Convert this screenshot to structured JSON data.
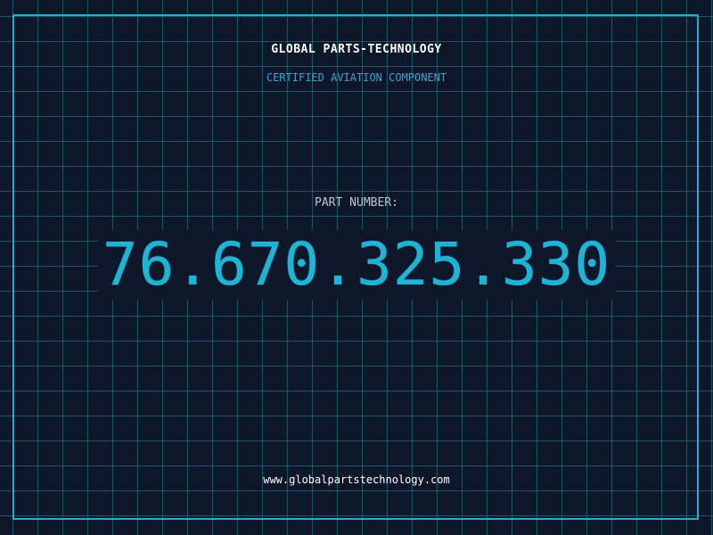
{
  "header": {
    "company_name": "GLOBAL PARTS-TECHNOLOGY",
    "subtitle": "CERTIFIED AVIATION COMPONENT"
  },
  "part": {
    "label": "PART NUMBER:",
    "number": "76.670.325.330"
  },
  "footer": {
    "url": "www.globalpartstechnology.com"
  },
  "colors": {
    "background": "#0f172a",
    "grid": "#1d5866",
    "frame": "#2fa9c9",
    "accent": "#1fb4d6"
  }
}
